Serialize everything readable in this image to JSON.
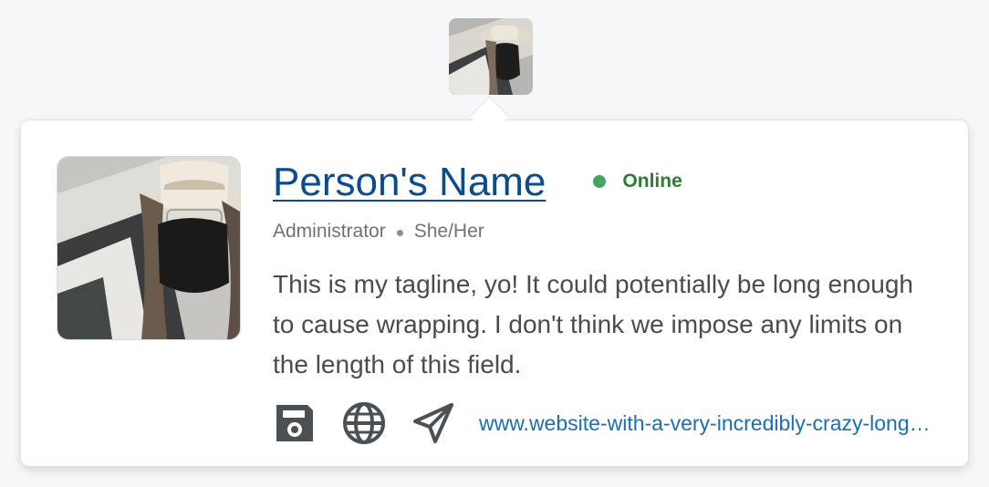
{
  "profile": {
    "name": "Person's Name",
    "status": "Online",
    "role": "Administrator",
    "pronouns": "She/Her",
    "tagline": "This is my tagline, yo! It could potentially be long enough to cause wrapping. I don't think we impose any limits on the length of this field.",
    "website": "www.website-with-a-very-incredibly-crazy-long-url.com"
  },
  "icons": {
    "avatar_thumb": "avatar-photo",
    "save": "save-icon",
    "globe": "globe-icon",
    "send": "send-icon"
  },
  "colors": {
    "name_link": "#0b4c8c",
    "status_online": "#46a661",
    "status_text": "#2b7a36",
    "website_link": "#1a6eb5"
  }
}
